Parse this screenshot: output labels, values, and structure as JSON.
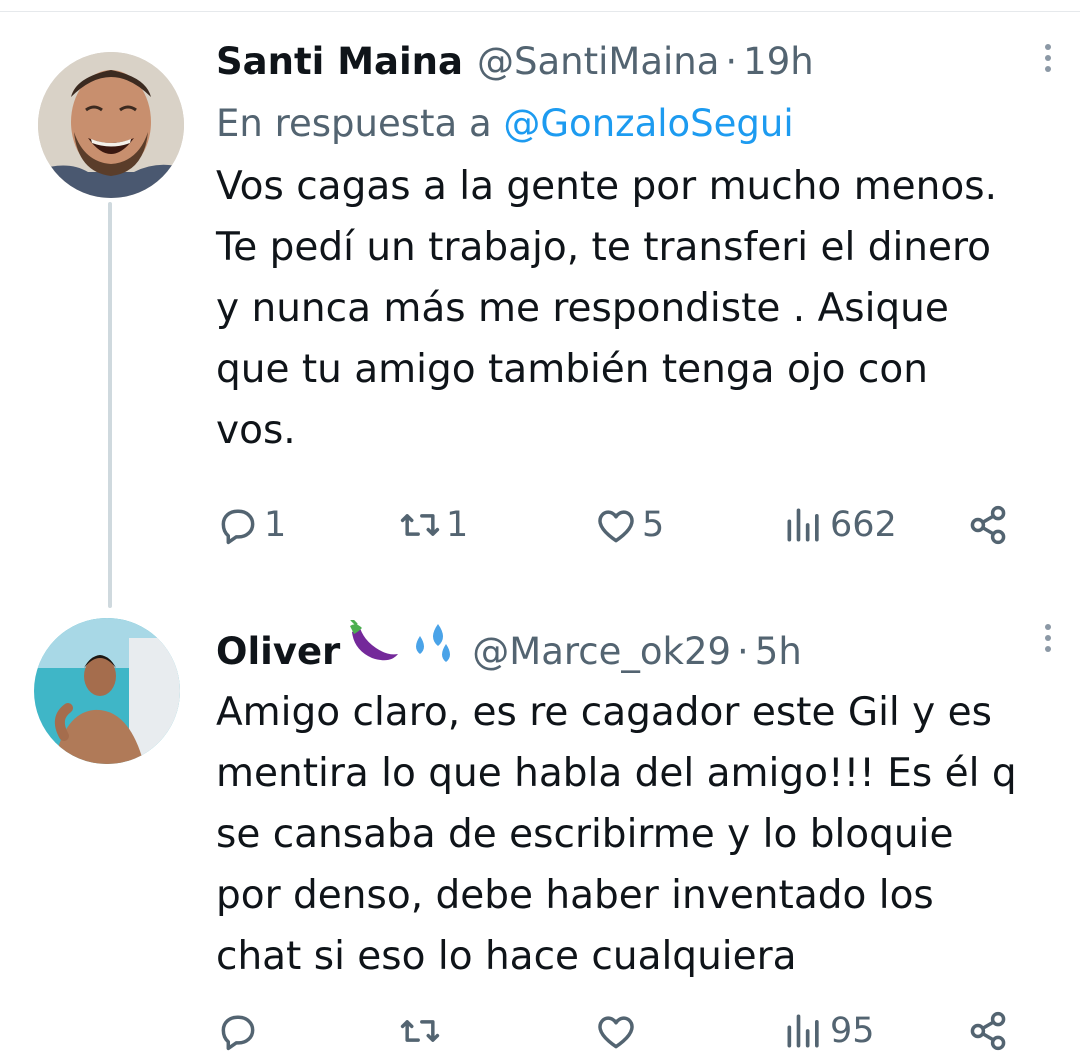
{
  "tweets": [
    {
      "name": "Santi Maina",
      "handle": "@SantiMaina",
      "time": "19h",
      "reply_prefix": "En respuesta a",
      "reply_mention": "@GonzaloSegui",
      "text": "Vos cagas a la gente por mucho menos.\nTe pedí un trabajo, te transferi el dinero\ny nunca más me respondiste . Asique\nque tu amigo también tenga ojo con\nvos.",
      "replies": "1",
      "retweets": "1",
      "likes": "5",
      "views": "662"
    },
    {
      "name": "Oliver",
      "name_emoji": [
        "eggplant-emoji",
        "sweat-droplets-emoji"
      ],
      "handle": "@Marce_ok29",
      "time": "5h",
      "text": "Amigo claro, es re cagador este Gil y es\nmentira lo que habla del amigo!!! Es él q\nse cansaba de escribirme y lo bloquie\npor denso, debe haber inventado los\nchat si eso lo hace cualquiera",
      "replies": "",
      "retweets": "",
      "likes": "",
      "views": "95"
    }
  ],
  "dot_separator": "·",
  "colors": {
    "text": "#0f1419",
    "secondary": "#536471",
    "link": "#1d9bf0",
    "thread_line": "#cfd9de"
  }
}
